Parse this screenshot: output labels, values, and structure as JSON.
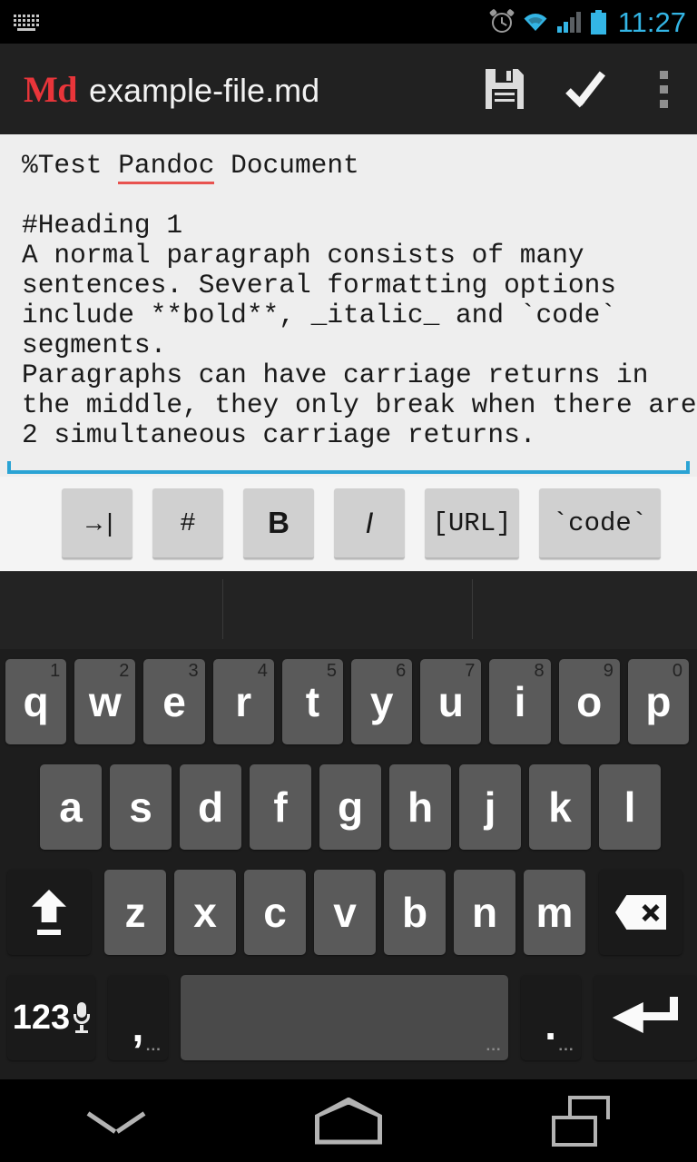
{
  "statusbar": {
    "ime_icon": "keyboard-icon",
    "alarm_icon": "alarm-clock-icon",
    "wifi_icon": "wifi-icon",
    "signal_icon": "signal-bars-icon",
    "battery_icon": "battery-icon",
    "clock": "11:27",
    "accent_color": "#33b5e5"
  },
  "actionbar": {
    "logo": "Md",
    "logo_color": "#e8353a",
    "filename": "example-file.md",
    "background": "#212121",
    "save_icon": "save-floppy-icon",
    "done_icon": "checkmark-icon",
    "overflow_icon": "overflow-menu-icon"
  },
  "editor": {
    "background": "#eeeeee",
    "focus_color": "#2aa3d4",
    "misspelled_word": "Pandoc",
    "misspell_underline_color": "#e8524f",
    "line_title_prefix": "%Test ",
    "line_title_suffix": " Document",
    "body": "\n\n#Heading 1\nA normal paragraph consists of many\nsentences. Several formatting options\ninclude **bold**, _italic_ and `code`\nsegments.\nParagraphs can have carriage returns in\nthe middle, they only break when there are\n2 simultaneous carriage returns."
  },
  "mdtoolbar": {
    "background": "#f4f4f4",
    "buttons": [
      {
        "label": "→|",
        "name": "tab"
      },
      {
        "label": "#",
        "name": "heading"
      },
      {
        "label": "B",
        "name": "bold"
      },
      {
        "label": "I",
        "name": "italic"
      },
      {
        "label": "[URL]",
        "name": "url"
      },
      {
        "label": "`code`",
        "name": "code"
      }
    ]
  },
  "keyboard": {
    "background": "#1d1d1d",
    "suggestion_strip": "",
    "row1": [
      {
        "label": "q",
        "num": "1"
      },
      {
        "label": "w",
        "num": "2"
      },
      {
        "label": "e",
        "num": "3"
      },
      {
        "label": "r",
        "num": "4"
      },
      {
        "label": "t",
        "num": "5"
      },
      {
        "label": "y",
        "num": "6"
      },
      {
        "label": "u",
        "num": "7"
      },
      {
        "label": "i",
        "num": "8"
      },
      {
        "label": "o",
        "num": "9"
      },
      {
        "label": "p",
        "num": "0"
      }
    ],
    "row2": [
      {
        "label": "a"
      },
      {
        "label": "s"
      },
      {
        "label": "d"
      },
      {
        "label": "f"
      },
      {
        "label": "g"
      },
      {
        "label": "h"
      },
      {
        "label": "j"
      },
      {
        "label": "k"
      },
      {
        "label": "l"
      }
    ],
    "row3": [
      {
        "label": "z"
      },
      {
        "label": "x"
      },
      {
        "label": "c"
      },
      {
        "label": "v"
      },
      {
        "label": "b"
      },
      {
        "label": "n"
      },
      {
        "label": "m"
      }
    ],
    "shift_icon": "shift-icon",
    "backspace_icon": "backspace-icon",
    "symbols_label": "123",
    "mic_icon": "microphone-icon",
    "comma_label": ",",
    "comma_hint": "...",
    "space_label": "",
    "space_hint": "...",
    "period_label": ".",
    "period_hint": "...",
    "enter_icon": "enter-return-icon"
  },
  "navbar": {
    "back_icon": "hide-keyboard-down-icon",
    "home_icon": "home-icon",
    "recents_icon": "recent-apps-icon"
  }
}
